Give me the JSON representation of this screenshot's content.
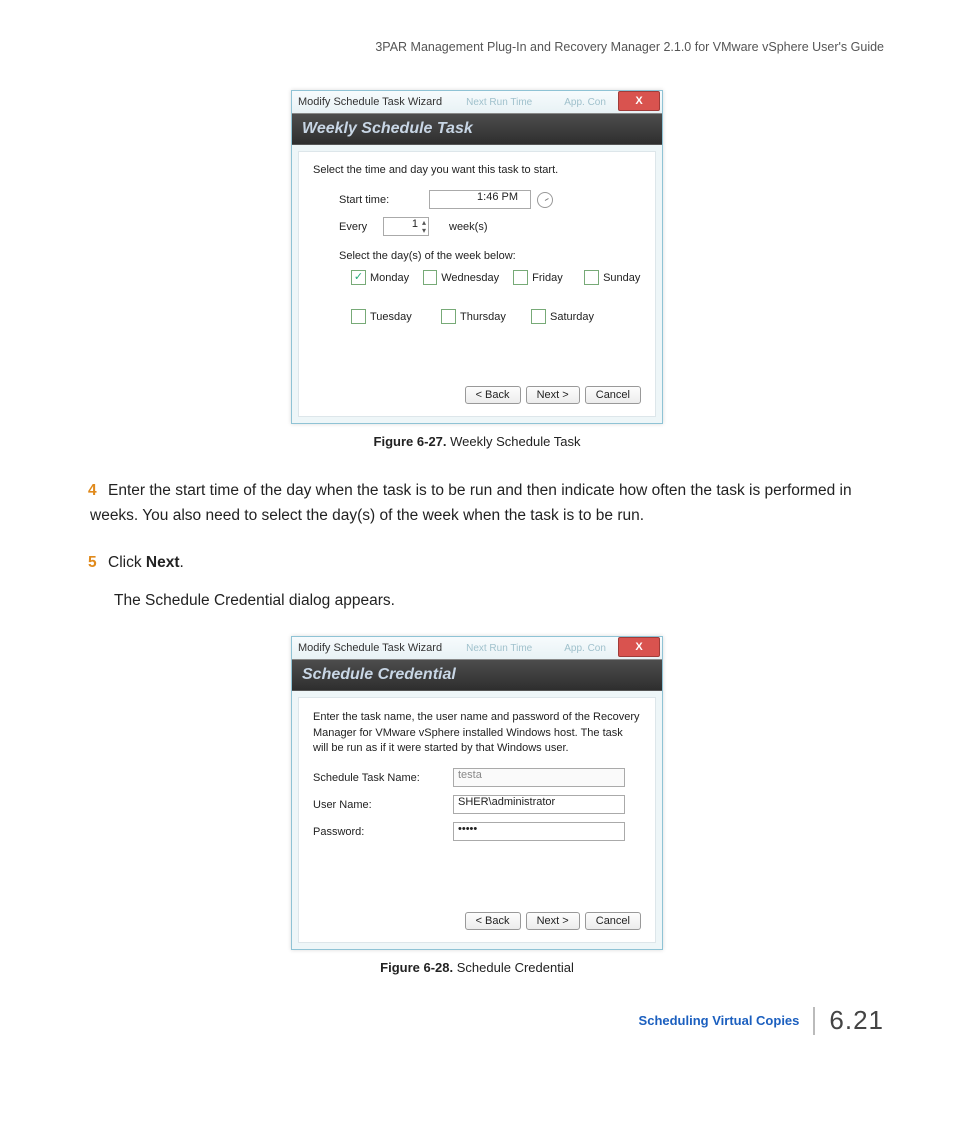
{
  "header": "3PAR Management Plug-In and Recovery Manager 2.1.0 for VMware vSphere User's Guide",
  "figure1": {
    "caption_no": "Figure 6-27.",
    "caption_text": "Weekly Schedule Task",
    "titlebar": "Modify Schedule Task Wizard",
    "faint1": "Next Run Time",
    "faint2": "App. Con",
    "close": "X",
    "banner": "Weekly Schedule Task",
    "intro": "Select the time and day you want this task to start.",
    "start_label": "Start time:",
    "start_value": "1:46 PM",
    "every_label": "Every",
    "every_value": "1",
    "every_unit": "week(s)",
    "days_label": "Select the day(s) of the week below:",
    "days": {
      "mon": "Monday",
      "tue": "Tuesday",
      "wed": "Wednesday",
      "thu": "Thursday",
      "fri": "Friday",
      "sat": "Saturday",
      "sun": "Sunday"
    },
    "checked_day": "mon",
    "back": "< Back",
    "next": "Next >",
    "cancel": "Cancel"
  },
  "step4": {
    "num": "4",
    "text": "Enter the start time of the day when the task is to be run and then indicate how often the task is performed in weeks. You also need to select the day(s) of the week when the task is to be run."
  },
  "step5": {
    "num": "5",
    "text_pre": "Click ",
    "text_bold": "Next",
    "text_post": ".",
    "sub": "The Schedule Credential dialog appears."
  },
  "figure2": {
    "caption_no": "Figure 6-28.",
    "caption_text": "Schedule Credential",
    "titlebar": "Modify Schedule Task Wizard",
    "faint1": "Next Run Time",
    "faint2": "App. Con",
    "close": "X",
    "banner": "Schedule Credential",
    "intro": "Enter the task name, the user name and password of the Recovery Manager for VMware vSphere installed Windows host. The task will be run as if it were started by that Windows user.",
    "taskname_label": "Schedule Task Name:",
    "taskname_value": "testa",
    "user_label": "User Name:",
    "user_value": "SHER\\administrator",
    "pass_label": "Password:",
    "pass_value": "•••••",
    "back": "< Back",
    "next": "Next >",
    "cancel": "Cancel"
  },
  "footer": {
    "label": "Scheduling Virtual Copies",
    "page": "6.21"
  }
}
